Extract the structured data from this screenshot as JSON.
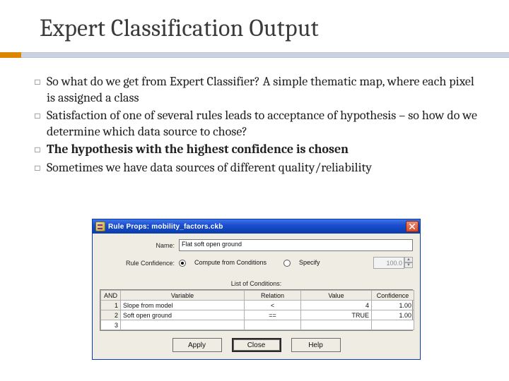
{
  "slide": {
    "title": "Expert Classification Output",
    "bullets": [
      {
        "text": "So what do we get from Expert Classifier? A simple thematic map, where each pixel is assigned a class",
        "bold": false
      },
      {
        "text": "Satisfaction of one of several rules leads to acceptance of hypothesis – so how do we determine which data source to chose?",
        "bold": false
      },
      {
        "text": "The hypothesis with the highest confidence is chosen",
        "bold": true
      },
      {
        "text": "Sometimes we have data sources of different quality/reliability",
        "bold": false
      }
    ]
  },
  "dialog": {
    "title": "Rule Props: mobility_factors.ckb",
    "name_label": "Name:",
    "name_value": "Flat soft open ground",
    "conf_label": "Rule Confidence:",
    "radio_compute": "Compute from Conditions",
    "radio_specify": "Specify",
    "specify_value": "100.0",
    "list_label": "List of Conditions:",
    "headers": {
      "and": "AND",
      "variable": "Variable",
      "relation": "Relation",
      "value": "Value",
      "confidence": "Confidence"
    },
    "rows": [
      {
        "n": "1",
        "variable": "Slope from model",
        "relation": "<",
        "value": "4",
        "confidence": "1.00"
      },
      {
        "n": "2",
        "variable": "Soft open ground",
        "relation": "==",
        "value": "TRUE",
        "confidence": "1.00"
      },
      {
        "n": "3",
        "variable": "",
        "relation": "",
        "value": "",
        "confidence": ""
      }
    ],
    "buttons": {
      "apply": "Apply",
      "close": "Close",
      "help": "Help"
    }
  }
}
